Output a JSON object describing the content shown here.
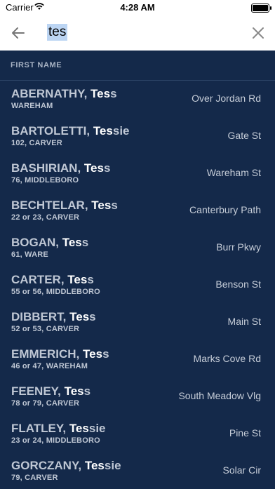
{
  "status_bar": {
    "carrier": "Carrier",
    "time": "4:28 AM"
  },
  "search": {
    "value": "tes"
  },
  "list_header": {
    "label": "FIRST NAME"
  },
  "rows": [
    {
      "last": "ABERNATHY",
      "first_match": "Tes",
      "first_rest": "s",
      "sub": "WAREHAM",
      "street": "Over Jordan Rd"
    },
    {
      "last": "BARTOLETTI",
      "first_match": "Tes",
      "first_rest": "sie",
      "sub": "102, CARVER",
      "street": "Gate St"
    },
    {
      "last": "BASHIRIAN",
      "first_match": "Tes",
      "first_rest": "s",
      "sub": "76, MIDDLEBORO",
      "street": "Wareham St"
    },
    {
      "last": "BECHTELAR",
      "first_match": "Tes",
      "first_rest": "s",
      "sub": "22 or 23, CARVER",
      "street": "Canterbury Path"
    },
    {
      "last": "BOGAN",
      "first_match": "Tes",
      "first_rest": "s",
      "sub": "61, WARE",
      "street": "Burr Pkwy"
    },
    {
      "last": "CARTER",
      "first_match": "Tes",
      "first_rest": "s",
      "sub": "55 or 56, MIDDLEBORO",
      "street": "Benson St"
    },
    {
      "last": "DIBBERT",
      "first_match": "Tes",
      "first_rest": "s",
      "sub": "52 or 53, CARVER",
      "street": "Main St"
    },
    {
      "last": "EMMERICH",
      "first_match": "Tes",
      "first_rest": "s",
      "sub": "46 or 47, WAREHAM",
      "street": "Marks Cove Rd"
    },
    {
      "last": "FEENEY",
      "first_match": "Tes",
      "first_rest": "s",
      "sub": "78 or 79, CARVER",
      "street": "South Meadow Vlg"
    },
    {
      "last": "FLATLEY",
      "first_match": "Tes",
      "first_rest": "sie",
      "sub": "23 or 24, MIDDLEBORO",
      "street": "Pine St"
    },
    {
      "last": "GORCZANY",
      "first_match": "Tes",
      "first_rest": "sie",
      "sub": "79, CARVER",
      "street": "Solar Cir"
    }
  ],
  "icons": {
    "back": "arrow-left-icon",
    "clear": "close-icon",
    "wifi": "wifi-icon",
    "battery": "battery-icon"
  },
  "colors": {
    "background": "#14294a",
    "highlight": "#bcd5f3"
  }
}
